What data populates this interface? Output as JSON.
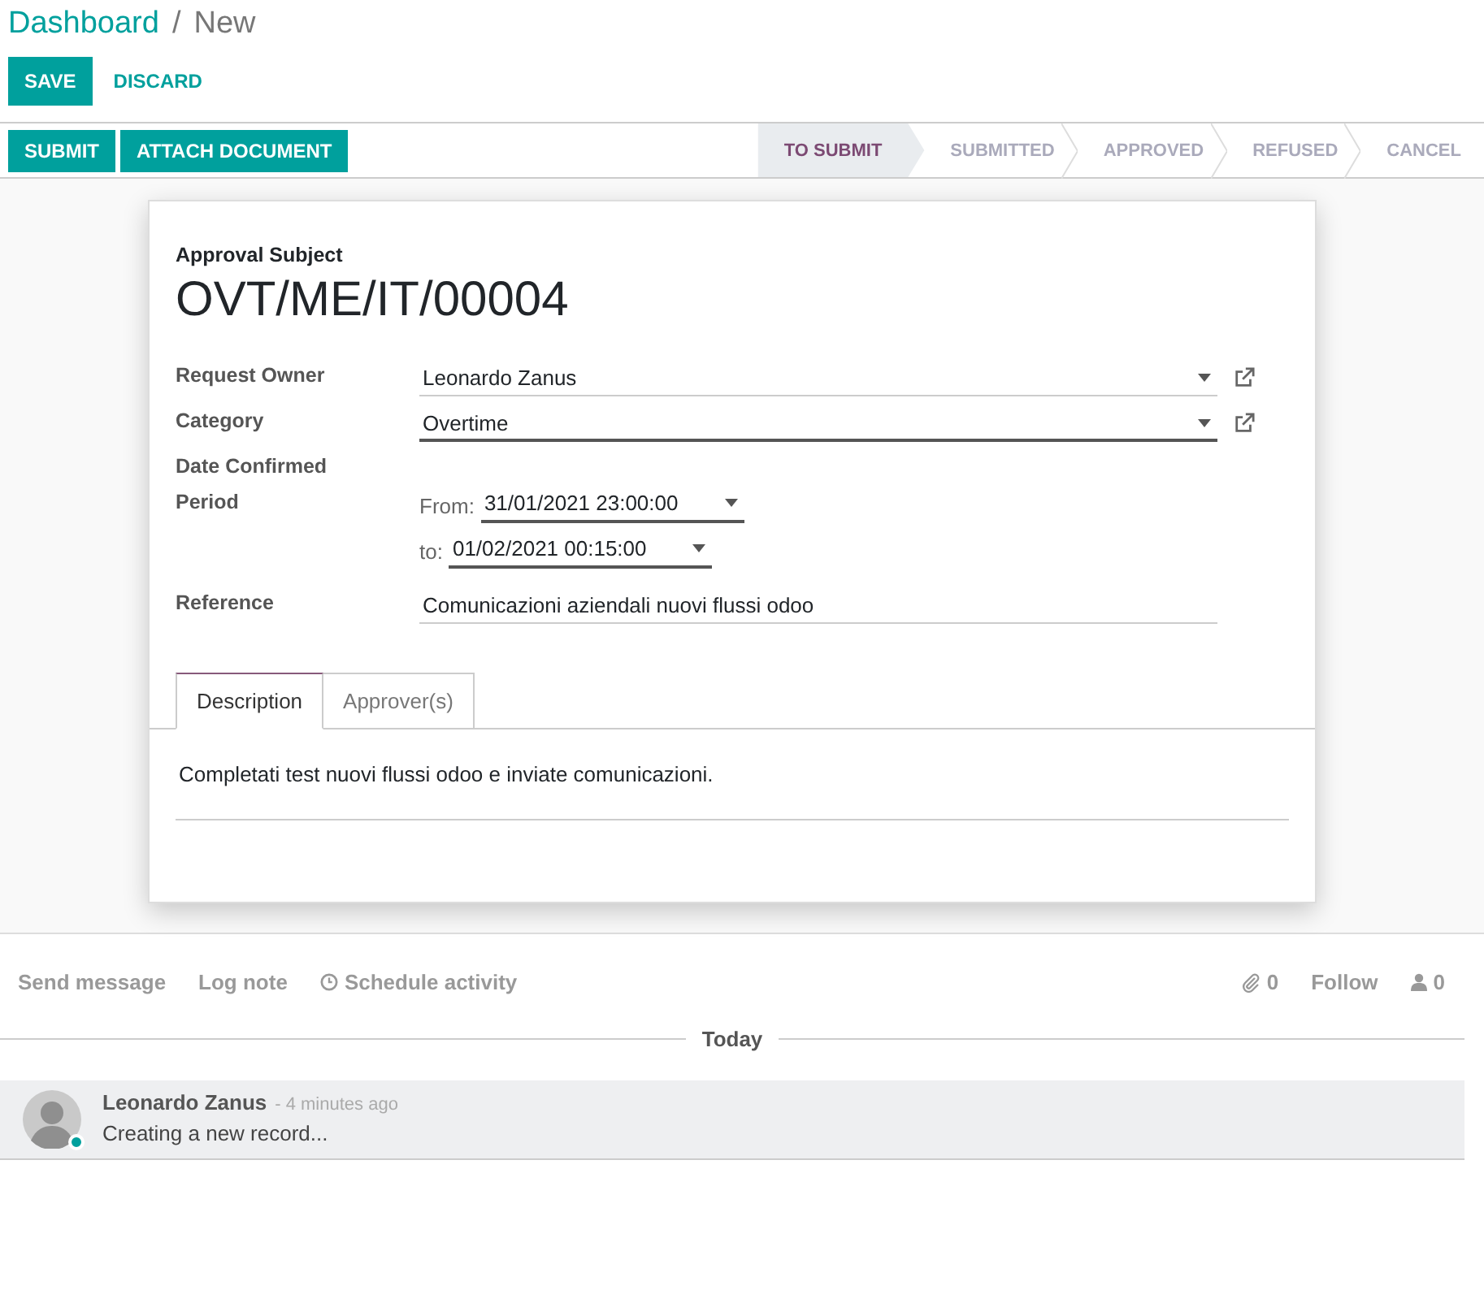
{
  "breadcrumb_separator": "/",
  "breadcrumb": [
    {
      "label": "Dashboard",
      "kind": "link"
    },
    {
      "label": "New",
      "kind": "current"
    }
  ],
  "actions": [
    {
      "label": "SAVE",
      "kind": "primary"
    },
    {
      "label": "DISCARD",
      "kind": "link"
    }
  ],
  "header_buttons": [
    "SUBMIT",
    "ATTACH DOCUMENT"
  ],
  "stages": [
    {
      "label": "TO SUBMIT",
      "selected": true
    },
    {
      "label": "SUBMITTED",
      "selected": false
    },
    {
      "label": "APPROVED",
      "selected": false
    },
    {
      "label": "REFUSED",
      "selected": false
    },
    {
      "label": "CANCEL",
      "selected": false
    }
  ],
  "form": {
    "subject_label": "Approval Subject",
    "subject": "OVT/ME/IT/00004",
    "fields": [
      {
        "label": "Request Owner",
        "kind": "many2one",
        "value": "Leonardo Zanus",
        "focused": false
      },
      {
        "label": "Category",
        "kind": "many2one",
        "value": "Overtime",
        "focused": true
      },
      {
        "label": "Date Confirmed",
        "kind": "empty"
      },
      {
        "label": "Period",
        "kind": "period",
        "from_label": "From:",
        "from": "31/01/2021 23:00:00",
        "to_label": "to:",
        "to": "01/02/2021 00:15:00"
      },
      {
        "label": "Reference",
        "kind": "text",
        "value": "Comunicazioni aziendali nuovi flussi odoo",
        "focused": false
      }
    ],
    "tabs": [
      {
        "label": "Description",
        "selected": true
      },
      {
        "label": "Approver(s)",
        "selected": false
      }
    ],
    "description": "Completati test nuovi flussi odoo e inviate comunicazioni."
  },
  "chatter": {
    "actions": [
      {
        "label": "Send message",
        "kind": "plain"
      },
      {
        "label": "Log note",
        "kind": "plain"
      },
      {
        "label": "Schedule activity",
        "kind": "clock"
      }
    ],
    "attachments": "0",
    "follow": "Follow",
    "followers": "0",
    "separator": "Today",
    "messages": [
      {
        "author": "Leonardo Zanus",
        "time": "- 4 minutes ago",
        "body": "Creating a new record...",
        "online": true
      }
    ]
  }
}
